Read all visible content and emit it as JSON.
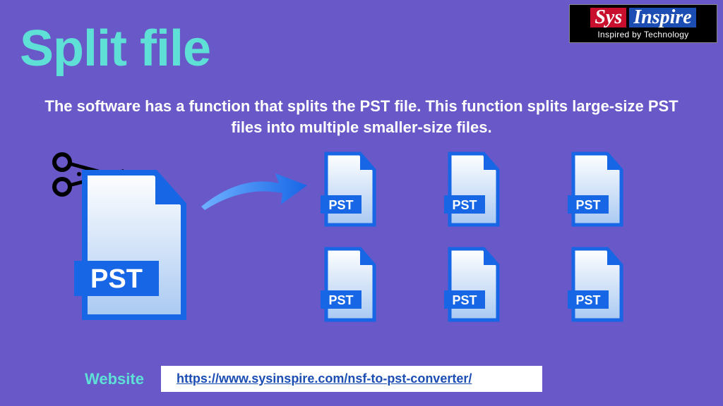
{
  "logo": {
    "part1": "Sys",
    "part2": "Inspire",
    "tagline": "Inspired by Technology"
  },
  "title": "Split file",
  "description": "The software has a function that splits the PST file. This function splits large-size PST files into multiple smaller-size files.",
  "file_label": "PST",
  "footer": {
    "label": "Website",
    "url": "https://www.sysinspire.com/nsf-to-pst-converter/"
  }
}
